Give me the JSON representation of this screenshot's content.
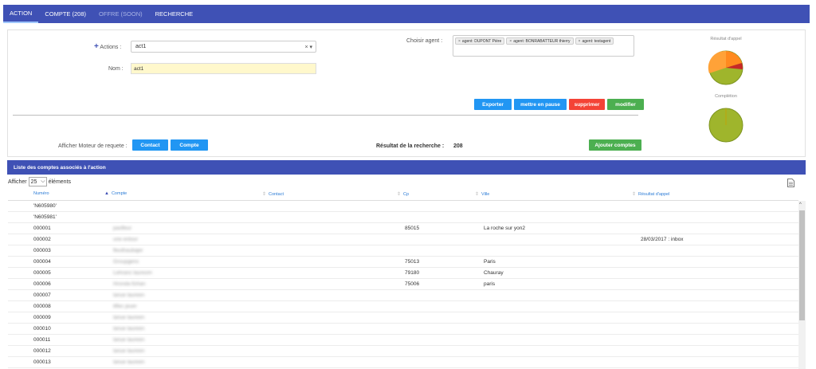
{
  "nav": {
    "tabs": [
      {
        "label": "ACTION"
      },
      {
        "label": "COMPTE (208)"
      },
      {
        "label": "OFFRE (SOON)"
      },
      {
        "label": "RECHERCHE"
      }
    ]
  },
  "form": {
    "actions_label": "Actions :",
    "actions_value": "act1",
    "actions_clear": "×",
    "actions_caret": "▾",
    "nom_label": "Nom :",
    "nom_value": "act1",
    "agent_label": "Choisir agent :",
    "agents": [
      "agent: DUPONT Pière",
      "agent: BONRABATTEUR thierry",
      "agent: testagent"
    ],
    "chip_remove": "×"
  },
  "actions": {
    "exporter": "Exporter",
    "pause": "mettre en pause",
    "supprimer": "supprimer",
    "modifier": "modifier"
  },
  "gauges": {
    "resultat_label": "Résultat d'appel",
    "completion_label": "Complétion"
  },
  "query": {
    "moteur_label": "Afficher Moteur de requete :",
    "contact_btn": "Contact",
    "compte_btn": "Compte",
    "resultat_recherche_label": "Résultat de la recherche :",
    "resultat_recherche_value": "208",
    "ajouter_btn": "Ajouter comptes"
  },
  "list": {
    "title": "Liste des comptes associés à l'action",
    "afficher": "Afficher",
    "page_size": "25",
    "elements": "éléments",
    "columns": [
      "Numéro",
      "Compte",
      "Contact",
      "Cp",
      "Ville",
      "Résultat d'appel"
    ],
    "rows": [
      {
        "numero": "'N605980'",
        "compte": "",
        "contact": "",
        "cp": "",
        "ville": "",
        "resultat": ""
      },
      {
        "numero": "'N605981'",
        "compte": "",
        "contact": "",
        "cp": "",
        "ville": "",
        "resultat": ""
      },
      {
        "numero": "000001",
        "compte": "pasfleur",
        "contact": "",
        "cp": "85015",
        "ville": "La roche sur yon2",
        "resultat": ""
      },
      {
        "numero": "000002",
        "compte": "une entour",
        "contact": "",
        "cp": "",
        "ville": "",
        "resultat": "28/03/2017 : inbox"
      },
      {
        "numero": "000003",
        "compte": "fleuthaubajer",
        "contact": "",
        "cp": "",
        "ville": "",
        "resultat": ""
      },
      {
        "numero": "000004",
        "compte": "Groupgens",
        "contact": "",
        "cp": "75013",
        "ville": "Paris",
        "resultat": ""
      },
      {
        "numero": "000005",
        "compte": "Lehranc laureom",
        "contact": "",
        "cp": "79180",
        "ville": "Chauray",
        "resultat": ""
      },
      {
        "numero": "000006",
        "compte": "Hronda fizhan",
        "contact": "",
        "cp": "75006",
        "ville": "paris",
        "resultat": ""
      },
      {
        "numero": "000007",
        "compte": "lanue laureen",
        "contact": "",
        "cp": "",
        "ville": "",
        "resultat": ""
      },
      {
        "numero": "000008",
        "compte": "tiflec jeuer",
        "contact": "",
        "cp": "",
        "ville": "",
        "resultat": ""
      },
      {
        "numero": "000009",
        "compte": "lanue laureen",
        "contact": "",
        "cp": "",
        "ville": "",
        "resultat": ""
      },
      {
        "numero": "000010",
        "compte": "lanue laureen",
        "contact": "",
        "cp": "",
        "ville": "",
        "resultat": ""
      },
      {
        "numero": "000011",
        "compte": "lanue laureen",
        "contact": "",
        "cp": "",
        "ville": "",
        "resultat": ""
      },
      {
        "numero": "000012",
        "compte": "lanue laureen",
        "contact": "",
        "cp": "",
        "ville": "",
        "resultat": ""
      },
      {
        "numero": "000013",
        "compte": "lanue laureen",
        "contact": "",
        "cp": "",
        "ville": "",
        "resultat": ""
      }
    ]
  },
  "colors": {
    "primary": "#3f51b5",
    "blue_btn": "#2196f3",
    "red_btn": "#f44336",
    "green_btn": "#4caf50",
    "gauge_olive": "#9fb52c",
    "gauge_orange": "#ff8a1f"
  },
  "icons": {
    "plus": "plus-icon",
    "document": "document-icon",
    "scroll_up": "chevron-up-icon"
  }
}
